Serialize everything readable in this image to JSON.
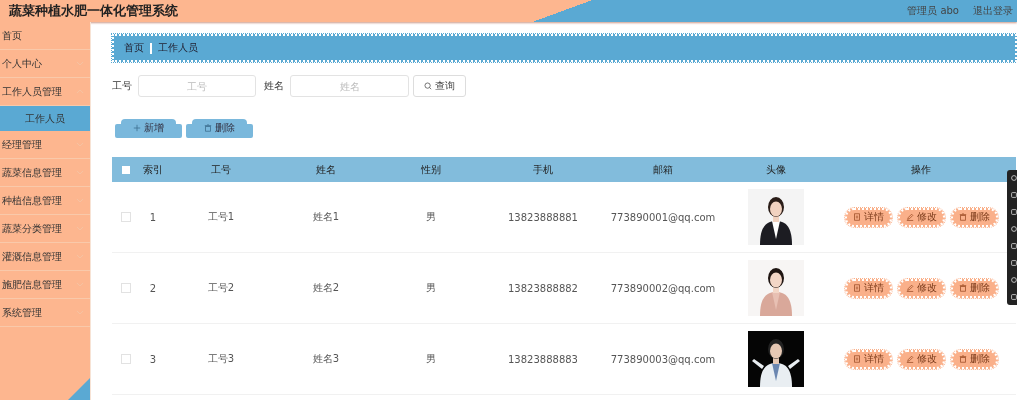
{
  "header": {
    "title": "蔬菜种植水肥一体化管理系统",
    "user": "管理员 abo",
    "logout": "退出登录"
  },
  "sidebar": {
    "items": [
      {
        "label": "首页",
        "expandable": false
      },
      {
        "label": "个人中心",
        "expandable": true,
        "expanded": false
      },
      {
        "label": "工作人员管理",
        "expandable": true,
        "expanded": true,
        "children": [
          {
            "label": "工作人员",
            "selected": true
          }
        ]
      },
      {
        "label": "经理管理",
        "expandable": true,
        "expanded": false
      },
      {
        "label": "蔬菜信息管理",
        "expandable": true,
        "expanded": false
      },
      {
        "label": "种植信息管理",
        "expandable": true,
        "expanded": false
      },
      {
        "label": "蔬菜分类管理",
        "expandable": true,
        "expanded": false
      },
      {
        "label": "灌溉信息管理",
        "expandable": true,
        "expanded": false
      },
      {
        "label": "施肥信息管理",
        "expandable": true,
        "expanded": false
      },
      {
        "label": "系统管理",
        "expandable": true,
        "expanded": false
      }
    ]
  },
  "breadcrumb": [
    "首页",
    "工作人员"
  ],
  "search": {
    "fields": [
      {
        "label": "工号",
        "placeholder": "工号"
      },
      {
        "label": "姓名",
        "placeholder": "姓名"
      }
    ],
    "button": "查询"
  },
  "actions": [
    {
      "kind": "add",
      "label": "新增"
    },
    {
      "kind": "delete",
      "label": "删除"
    }
  ],
  "table": {
    "columns": [
      "索引",
      "工号",
      "姓名",
      "性别",
      "手机",
      "邮箱",
      "头像",
      "操作"
    ],
    "header_checked": false,
    "rows": [
      {
        "checked": false,
        "cells": [
          "1",
          "工号1",
          "姓名1",
          "男",
          "13823888881",
          "773890001@qq.com"
        ],
        "buttons": [
          "详情",
          "修改",
          "删除"
        ]
      },
      {
        "checked": false,
        "cells": [
          "2",
          "工号2",
          "姓名2",
          "男",
          "13823888882",
          "773890002@qq.com"
        ],
        "buttons": [
          "详情",
          "修改",
          "删除"
        ]
      },
      {
        "checked": false,
        "cells": [
          "3",
          "工号3",
          "姓名3",
          "男",
          "13823888883",
          "773890003@qq.com"
        ],
        "buttons": [
          "详情",
          "修改",
          "删除"
        ]
      }
    ]
  }
}
